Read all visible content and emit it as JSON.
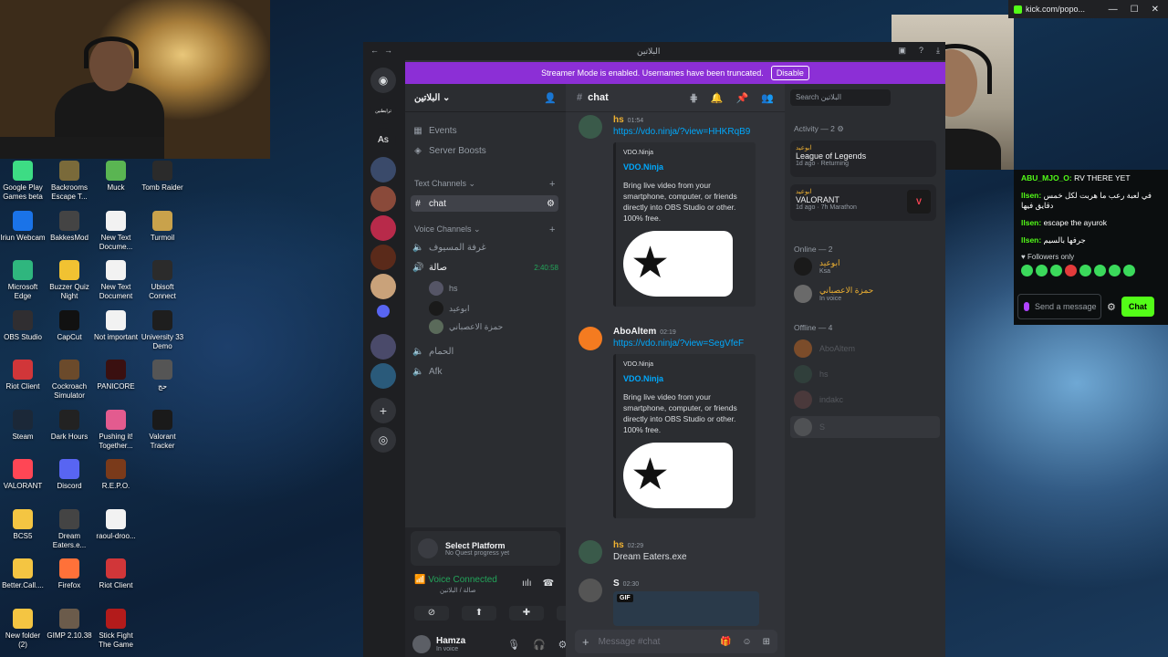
{
  "desktop_icons": [
    {
      "label": "Google Play Games beta",
      "col": 0,
      "row": 0,
      "color": "#3ddc84"
    },
    {
      "label": "Backrooms Escape T...",
      "col": 1,
      "row": 0,
      "color": "#7a6a3a"
    },
    {
      "label": "Muck",
      "col": 2,
      "row": 0,
      "color": "#5ab552"
    },
    {
      "label": "Tomb Raider",
      "col": 3,
      "row": 0,
      "color": "#2b2b2b"
    },
    {
      "label": "Iriun Webcam",
      "col": 0,
      "row": 1,
      "color": "#1a73e8"
    },
    {
      "label": "BakkesMod",
      "col": 1,
      "row": 1,
      "color": "#444444"
    },
    {
      "label": "New Text Docume...",
      "col": 2,
      "row": 1,
      "color": "#f2f2f2"
    },
    {
      "label": "Turmoil",
      "col": 3,
      "row": 1,
      "color": "#c9a24b"
    },
    {
      "label": "Microsoft Edge",
      "col": 0,
      "row": 2,
      "color": "#2fb67e"
    },
    {
      "label": "Buzzer Quiz Night",
      "col": 1,
      "row": 2,
      "color": "#f1c232"
    },
    {
      "label": "New Text Document",
      "col": 2,
      "row": 2,
      "color": "#f2f2f2"
    },
    {
      "label": "Ubisoft Connect",
      "col": 3,
      "row": 2,
      "color": "#2b2b2b"
    },
    {
      "label": "OBS Studio",
      "col": 0,
      "row": 3,
      "color": "#302e31"
    },
    {
      "label": "CapCut",
      "col": 1,
      "row": 3,
      "color": "#111111"
    },
    {
      "label": "Not important",
      "col": 2,
      "row": 3,
      "color": "#f2f2f2"
    },
    {
      "label": "University 33 Demo",
      "col": 3,
      "row": 3,
      "color": "#1e1e1e"
    },
    {
      "label": "Riot Client",
      "col": 0,
      "row": 4,
      "color": "#d13639"
    },
    {
      "label": "Cockroach Simulator",
      "col": 1,
      "row": 4,
      "color": "#6b4a2b"
    },
    {
      "label": "PANICORE",
      "col": 2,
      "row": 4,
      "color": "#3a1010"
    },
    {
      "label": "حج",
      "col": 3,
      "row": 4,
      "color": "#555555"
    },
    {
      "label": "Steam",
      "col": 0,
      "row": 5,
      "color": "#1b2838"
    },
    {
      "label": "Dark Hours",
      "col": 1,
      "row": 5,
      "color": "#222222"
    },
    {
      "label": "Pushing it! Together...",
      "col": 2,
      "row": 5,
      "color": "#e35b8f"
    },
    {
      "label": "Valorant Tracker",
      "col": 3,
      "row": 5,
      "color": "#1a1a1a"
    },
    {
      "label": "VALORANT",
      "col": 0,
      "row": 6,
      "color": "#ff4655"
    },
    {
      "label": "Discord",
      "col": 1,
      "row": 6,
      "color": "#5865f2"
    },
    {
      "label": "R.E.P.O.",
      "col": 2,
      "row": 6,
      "color": "#7a3a1a"
    },
    {
      "label": "BCS5",
      "col": 0,
      "row": 7,
      "color": "#f4c542"
    },
    {
      "label": "Dream Eaters.e...",
      "col": 1,
      "row": 7,
      "color": "#444444"
    },
    {
      "label": "raoul-droo...",
      "col": 2,
      "row": 7,
      "color": "#f2f2f2"
    },
    {
      "label": "Better.Call....",
      "col": 0,
      "row": 8,
      "color": "#f4c542"
    },
    {
      "label": "Firefox",
      "col": 1,
      "row": 8,
      "color": "#ff7139"
    },
    {
      "label": "Riot Client",
      "col": 2,
      "row": 8,
      "color": "#d13639"
    },
    {
      "label": "New folder (2)",
      "col": 0,
      "row": 9,
      "color": "#f4c542"
    },
    {
      "label": "GIMP 2.10.38",
      "col": 1,
      "row": 9,
      "color": "#6b5b4b"
    },
    {
      "label": "Stick Fight The Game",
      "col": 2,
      "row": 9,
      "color": "#b31b1b"
    }
  ],
  "browser": {
    "tab_title": "kick.com/popo..."
  },
  "kick_chat": {
    "messages": [
      {
        "user": "ABU_MJO_O:",
        "text": "RV THERE YET"
      },
      {
        "user": "llsen:",
        "text": "في لعبة رعب ما هربت لكل خمس دقايق فيها"
      },
      {
        "user": "llsen:",
        "text": "escape the ayurok"
      },
      {
        "user": "llsen:",
        "text": "جرفها بالسيم"
      }
    ],
    "followers_only": "Followers only",
    "send_placeholder": "Send a message",
    "chat_button": "Chat"
  },
  "discord": {
    "window_title": "البلاتين",
    "streamer_banner": "Streamer Mode is enabled. Usernames have been truncated.",
    "disable_label": "Disable",
    "server_name": "البلاتين",
    "guild_labels": {
      "dm": "As",
      "short": "ترابطنين"
    },
    "events": "Events",
    "server_boosts": "Server Boosts",
    "text_channels_cat": "Text Channels",
    "voice_channels_cat": "Voice Channels",
    "text_channels": [
      {
        "name": "chat"
      }
    ],
    "voice_channels": [
      {
        "name": "غرفة المسيوف"
      },
      {
        "name": "صالة",
        "timer": "2:40:58"
      },
      {
        "name": "الحمام"
      },
      {
        "name": "Afk"
      }
    ],
    "voice_users": [
      {
        "name": "hs"
      },
      {
        "name": "ابوعيد"
      },
      {
        "name": "حمزة الاعصباني"
      }
    ],
    "activity_title": "Select Platform",
    "activity_sub": "No Quest progress yet",
    "voice_connected": "Voice Connected",
    "voice_location": "صالة / البلاتين",
    "me_name": "Hamza",
    "me_status": "In voice",
    "channel_header": "chat",
    "messages": [
      {
        "author": "hs",
        "time": "01:54",
        "link": "https://vdo.ninja/?view=HHKRqB9"
      },
      {
        "author": "AboAltem",
        "time": "02:19",
        "link": "https://vdo.ninja/?view=SegVfeF"
      },
      {
        "author": "hs",
        "time": "02:29",
        "text": "Dream Eaters.exe"
      },
      {
        "author": "S",
        "time": "02:30",
        "gif": "GIF"
      }
    ],
    "embed": {
      "provider": "VDO.Ninja",
      "title": "VDO.Ninja",
      "description": "Bring live video from your smartphone, computer, or friends directly into OBS Studio or other. 100% free."
    },
    "message_placeholder": "Message #chat",
    "search_placeholder": "Search البلاتين",
    "activity_header": "Activity — 2",
    "activities": [
      {
        "who": "ابوعيد",
        "game": "League of Legends",
        "sub": "1d ago · Returning"
      },
      {
        "who": "ابوعيد",
        "game": "VALORANT",
        "sub": "1d ago · 7h Marathon"
      }
    ],
    "online_header": "Online — 2",
    "online": [
      {
        "name": "ابوعيد",
        "sub": "Ksa"
      },
      {
        "name": "حمزة الاعصباني",
        "sub": "In voice"
      }
    ],
    "offline_header": "Offline — 4",
    "offline": [
      {
        "name": "AboAltem"
      },
      {
        "name": "hs"
      },
      {
        "name": "indakc"
      },
      {
        "name": "S"
      }
    ]
  },
  "colors": {
    "streamer_banner": "#8c2fd6",
    "kick_green": "#53fc18",
    "link": "#00a8fc",
    "voice_green": "#23a55a"
  }
}
